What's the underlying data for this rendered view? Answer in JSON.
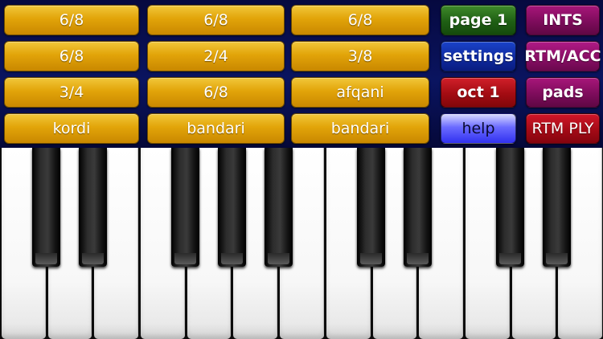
{
  "rhythm_buttons": [
    [
      "6/8",
      "6/8",
      "6/8"
    ],
    [
      "6/8",
      "2/4",
      "3/8"
    ],
    [
      "3/4",
      "6/8",
      "afqani"
    ],
    [
      "kordi",
      "bandari",
      "bandari"
    ]
  ],
  "controls": {
    "page": "page 1",
    "settings": "settings",
    "octave": "oct 1",
    "help": "help",
    "ints": "INTS",
    "rtm_acc": "RTM/ACC",
    "pads": "pads",
    "rtm_ply": "RTM PLY"
  },
  "keyboard": {
    "white_key_count": 13,
    "black_key_count": 9
  }
}
